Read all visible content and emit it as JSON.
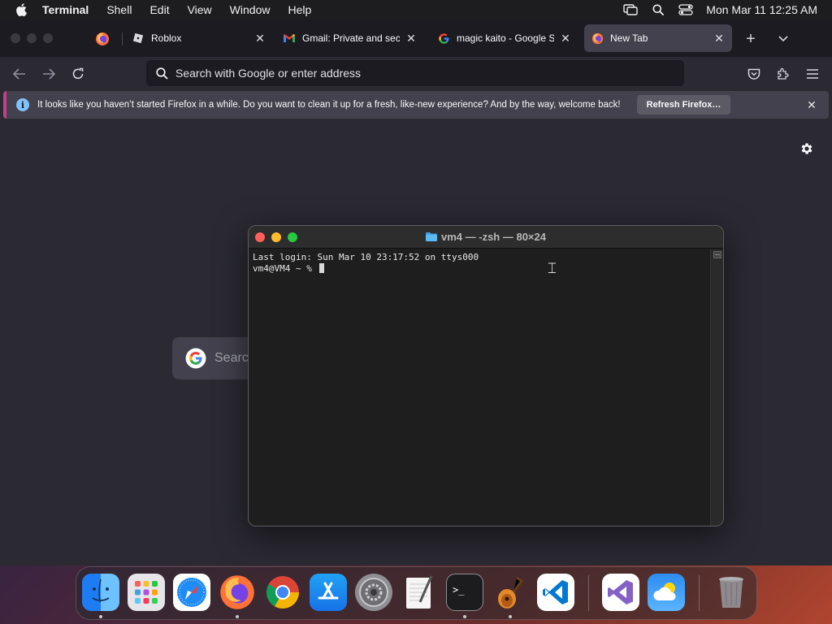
{
  "menubar": {
    "app_name": "Terminal",
    "menus": [
      "Shell",
      "Edit",
      "View",
      "Window",
      "Help"
    ],
    "clock": "Mon Mar 11  12:25 AM"
  },
  "firefox": {
    "tabs": [
      {
        "title": "Roblox",
        "favicon": "roblox-icon",
        "active": false
      },
      {
        "title": "Gmail: Private and secure",
        "favicon": "gmail-icon",
        "active": false
      },
      {
        "title": "magic kaito - Google Search",
        "favicon": "google-icon",
        "active": false
      },
      {
        "title": "New Tab",
        "favicon": "firefox-icon",
        "active": true
      }
    ],
    "urlbar_placeholder": "Search with Google or enter address",
    "infobar": {
      "message": "It looks like you haven’t started Firefox in a while. Do you want to clean it up for a fresh, like-new experience? And by the way, welcome back!",
      "button": "Refresh Firefox…"
    },
    "newtab_search_placeholder": "Search"
  },
  "terminal": {
    "title": "vm4 — -zsh — 80×24",
    "lines": [
      "Last login: Sun Mar 10 23:17:52 on ttys000",
      "vm4@VM4 ~ % "
    ]
  },
  "dock": {
    "apps": [
      "Finder",
      "Launchpad",
      "Safari",
      "Firefox",
      "Google Chrome",
      "App Store",
      "System Settings",
      "TextEdit",
      "Terminal",
      "GarageBand",
      "Visual Studio Code",
      "Visual Studio",
      "Weather",
      "Trash"
    ]
  },
  "colors": {
    "firefox_bg": "#2b2a33",
    "tabstrip_bg": "#1c1b22",
    "terminal_bg": "#1e1e1e",
    "infobar_accent": "#c2408a"
  }
}
